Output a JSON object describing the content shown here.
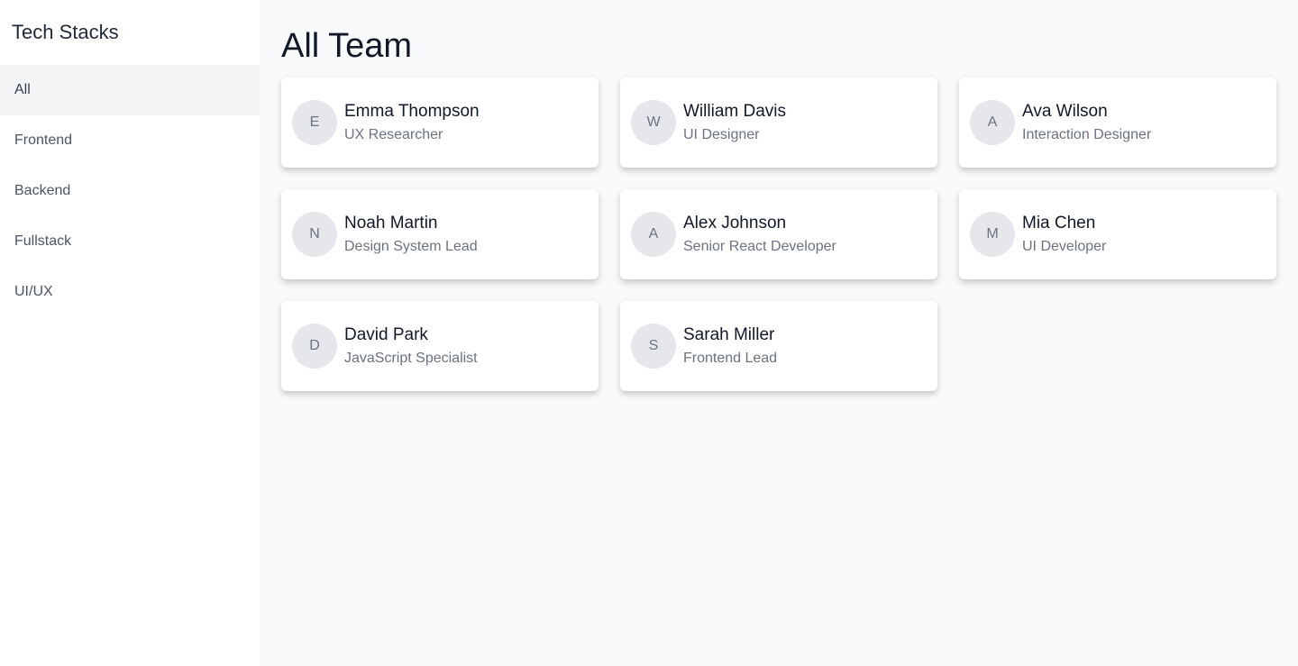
{
  "sidebar": {
    "title": "Tech Stacks",
    "items": [
      {
        "label": "All",
        "active": true
      },
      {
        "label": "Frontend",
        "active": false
      },
      {
        "label": "Backend",
        "active": false
      },
      {
        "label": "Fullstack",
        "active": false
      },
      {
        "label": "UI/UX",
        "active": false
      }
    ]
  },
  "main": {
    "title": "All Team",
    "members": [
      {
        "initial": "E",
        "name": "Emma Thompson",
        "role": "UX Researcher"
      },
      {
        "initial": "W",
        "name": "William Davis",
        "role": "UI Designer"
      },
      {
        "initial": "A",
        "name": "Ava Wilson",
        "role": "Interaction Designer"
      },
      {
        "initial": "N",
        "name": "Noah Martin",
        "role": "Design System Lead"
      },
      {
        "initial": "A",
        "name": "Alex Johnson",
        "role": "Senior React Developer"
      },
      {
        "initial": "M",
        "name": "Mia Chen",
        "role": "UI Developer"
      },
      {
        "initial": "D",
        "name": "David Park",
        "role": "JavaScript Specialist"
      },
      {
        "initial": "S",
        "name": "Sarah Miller",
        "role": "Frontend Lead"
      }
    ]
  },
  "colors": {
    "background": "#f9fafb",
    "sidebar": "#ffffff",
    "active_nav": "#f3f4f6",
    "avatar": "#e5e7eb"
  }
}
